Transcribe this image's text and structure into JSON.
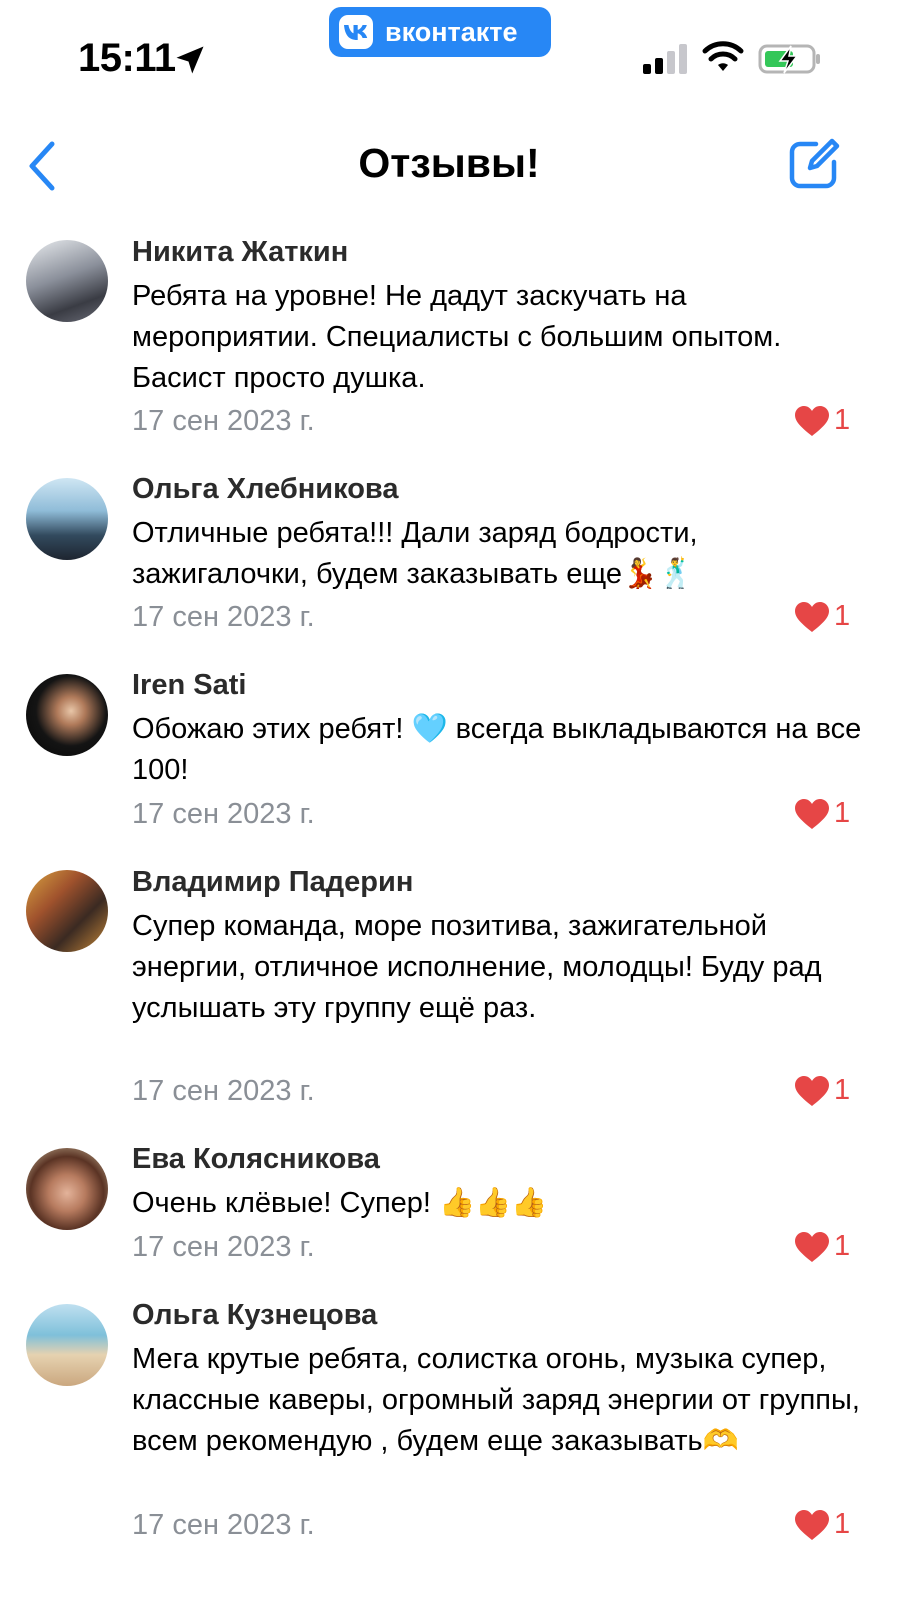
{
  "status_bar": {
    "time": "15:11",
    "app_badge": "вконтакте",
    "accent": "#2787f5"
  },
  "nav": {
    "title": "Отзывы!",
    "back_icon": "chevron-left-icon",
    "compose_icon": "compose-icon"
  },
  "reviews": [
    {
      "author": "Никита Жаткин",
      "text": "Ребята на уровне! Не дадут заскучать на мероприятии. Специалисты с большим опытом. Басист просто душка.",
      "date": "17 сен 2023 г.",
      "likes": "1"
    },
    {
      "author": "Ольга Хлебникова",
      "text": "Отличные ребята!!! Дали заряд бодрости, зажигалочки, будем заказывать еще💃🕺",
      "date": "17 сен 2023 г.",
      "likes": "1"
    },
    {
      "author": "Iren Sati",
      "text": "Обожаю этих ребят! 🩵 всегда выкладываются на все 100!",
      "date": "17 сен 2023 г.",
      "likes": "1"
    },
    {
      "author": "Владимир Падерин",
      "text": "Супер команда, море позитива, зажигательной энергии, отличное исполнение, молодцы! Буду рад услышать эту группу ещё раз.",
      "date": "17 сен 2023 г.",
      "likes": "1"
    },
    {
      "author": "Ева Колясникова",
      "text": "Очень клёвые! Супер! 👍👍👍",
      "date": "17 сен 2023 г.",
      "likes": "1"
    },
    {
      "author": "Ольга Кузнецова",
      "text": "Мега крутые ребята, солистка огонь, музыка супер, классные каверы, огромный заряд энергии от группы, всем рекомендую , будем еще заказывать🫶",
      "date": "17 сен 2023 г.",
      "likes": "1"
    }
  ]
}
